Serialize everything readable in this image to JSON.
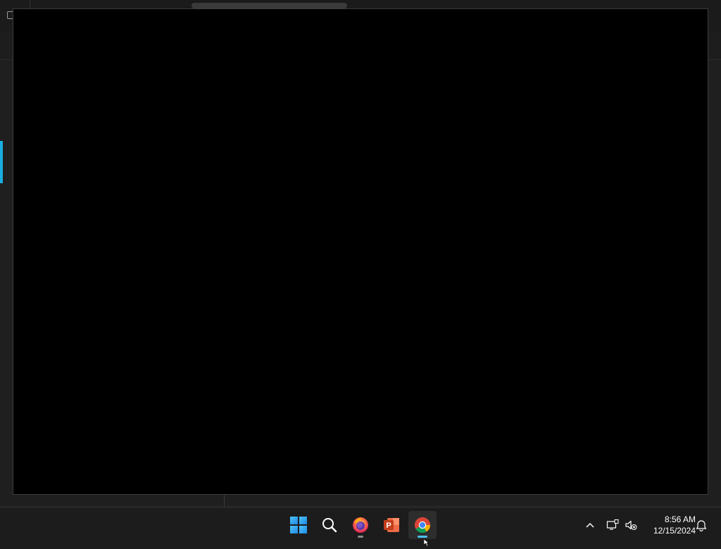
{
  "taskbar": {
    "apps": [
      {
        "name": "Start",
        "icon": "windows-start-icon"
      },
      {
        "name": "Search",
        "icon": "search-icon"
      },
      {
        "name": "Firefox",
        "icon": "firefox-icon",
        "running": true
      },
      {
        "name": "PowerPoint",
        "icon": "powerpoint-icon"
      },
      {
        "name": "Google Chrome",
        "icon": "chrome-icon",
        "running": true,
        "focused": true
      }
    ],
    "tray": {
      "chevron_icon": "chevron-up-icon",
      "network_icon": "network-icon",
      "volume_icon": "volume-muted-icon",
      "time": "8:56 AM",
      "date": "12/15/2024",
      "notification_icon": "bell-icon"
    }
  },
  "colors": {
    "taskbar_bg": "#1c1c1c",
    "window_bg": "#000000",
    "accent": "#1aaee0",
    "focus_indicator": "#4cc2ff"
  }
}
